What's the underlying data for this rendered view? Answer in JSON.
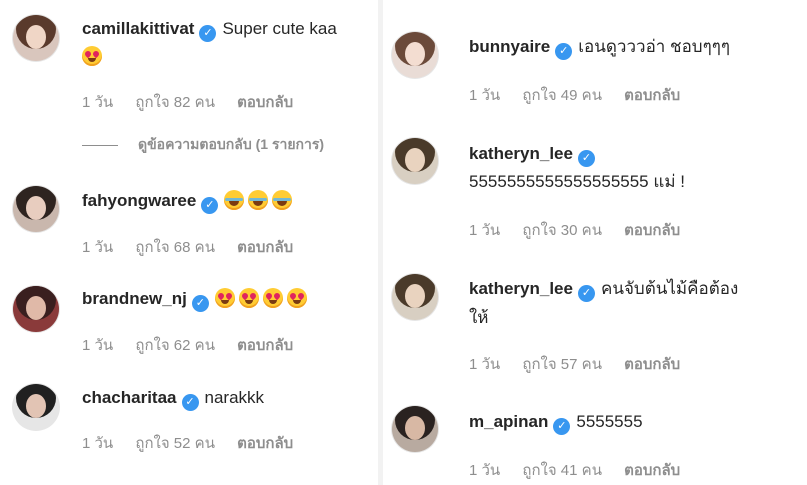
{
  "left_column": {
    "comments": [
      {
        "username": "camillakittivat",
        "text": "Super cute kaa",
        "emojis": [
          "heart-eyes"
        ],
        "time": "1 วัน",
        "likes": "ถูกใจ 82 คน",
        "reply": "ตอบกลับ",
        "avatar_colors": {
          "bg": "#d9c6bd",
          "hair": "#5a3a2c",
          "face": "#f0d6c6"
        }
      },
      {
        "username": "fahyongwaree",
        "text": "",
        "emojis": [
          "laugh",
          "laugh",
          "laugh"
        ],
        "time": "1 วัน",
        "likes": "ถูกใจ 68 คน",
        "reply": "ตอบกลับ",
        "avatar_colors": {
          "bg": "#c9b7ad",
          "hair": "#2e2420",
          "face": "#e8cdbf"
        }
      },
      {
        "username": "brandnew_nj",
        "text": "",
        "emojis": [
          "heart-eyes",
          "heart-eyes",
          "heart-eyes",
          "heart-eyes"
        ],
        "time": "1 วัน",
        "likes": "ถูกใจ 62 คน",
        "reply": "ตอบกลับ",
        "avatar_colors": {
          "bg": "#8a3a3a",
          "hair": "#3a1f1f",
          "face": "#e0b9a8"
        }
      },
      {
        "username": "chacharitaa",
        "text": "narakkk",
        "emojis": [],
        "time": "1 วัน",
        "likes": "ถูกใจ 52 คน",
        "reply": "ตอบกลับ",
        "avatar_colors": {
          "bg": "#e6e6e6",
          "hair": "#202020",
          "face": "#e2c4b4"
        }
      }
    ],
    "view_replies": "ดูข้อความตอบกลับ (1 รายการ)"
  },
  "right_column": {
    "comments": [
      {
        "username": "bunnyaire",
        "text": "เอนดูวววอ่า ชอบๆๆๆ",
        "emojis": [],
        "time": "1 วัน",
        "likes": "ถูกใจ 49 คน",
        "reply": "ตอบกลับ",
        "avatar_colors": {
          "bg": "#e9dcd6",
          "hair": "#6b4a3a",
          "face": "#f3ddd1"
        }
      },
      {
        "username": "katheryn_lee",
        "text": "5555555555555555555 แม่ !",
        "emojis": [],
        "time": "1 วัน",
        "likes": "ถูกใจ 30 คน",
        "reply": "ตอบกลับ",
        "avatar_colors": {
          "bg": "#d8cfc2",
          "hair": "#4a3a2a",
          "face": "#e9d3bf"
        }
      },
      {
        "username": "katheryn_lee",
        "text": "คนจับต้นไม้คือต้อง",
        "text_line2": "ให้",
        "emojis": [],
        "time": "1 วัน",
        "likes": "ถูกใจ 57 คน",
        "reply": "ตอบกลับ",
        "avatar_colors": {
          "bg": "#d8cfc2",
          "hair": "#4a3a2a",
          "face": "#e9d3bf"
        }
      },
      {
        "username": "m_apinan",
        "text": "5555555",
        "emojis": [],
        "time": "1 วัน",
        "likes": "ถูกใจ 41 คน",
        "reply": "ตอบกลับ",
        "avatar_colors": {
          "bg": "#b8aaa0",
          "hair": "#2a2220",
          "face": "#d8b8a4"
        }
      }
    ]
  },
  "colors": {
    "verified_blue": "#3897f0",
    "meta_gray": "#8e8e8e",
    "text": "#262626"
  }
}
